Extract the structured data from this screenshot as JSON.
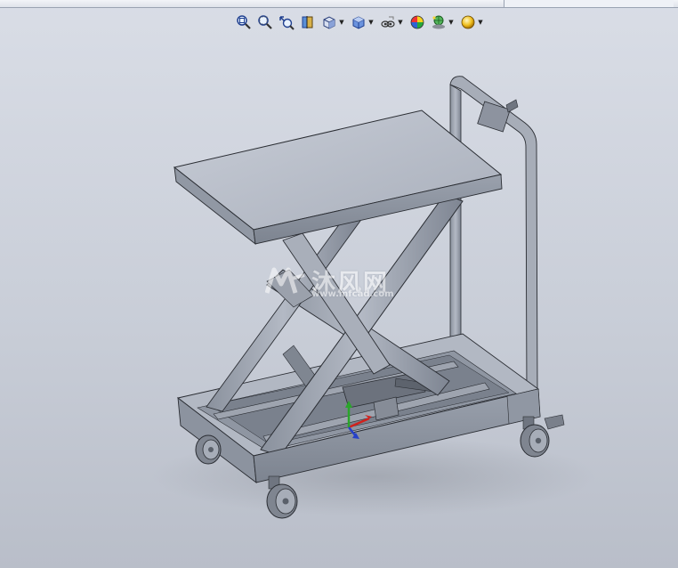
{
  "toolbar": {
    "tools": [
      {
        "icon": "zoom-to-fit-icon"
      },
      {
        "icon": "zoom-to-area-icon"
      },
      {
        "icon": "previous-view-icon"
      },
      {
        "icon": "section-view-icon"
      },
      {
        "icon": "view-orientation-icon",
        "dropdown": true
      },
      {
        "icon": "display-style-icon",
        "dropdown": true
      },
      {
        "icon": "hide-show-items-icon",
        "dropdown": true
      },
      {
        "icon": "edit-appearance-icon"
      },
      {
        "icon": "apply-scene-icon",
        "dropdown": true
      },
      {
        "icon": "view-settings-icon",
        "dropdown": true
      }
    ]
  },
  "watermark": {
    "logo": "沐风网",
    "url": "www.mfcad.com"
  },
  "colors": {
    "background_top": "#d9dde6",
    "background_bottom": "#b9bec9",
    "model_light": "#bfc4cf",
    "model_mid": "#8e95a2",
    "model_dark": "#5b616c",
    "edge": "#2a2d33"
  },
  "triad": {
    "x_color": "#d2211d",
    "y_color": "#2aa52b",
    "z_color": "#2540c9"
  }
}
